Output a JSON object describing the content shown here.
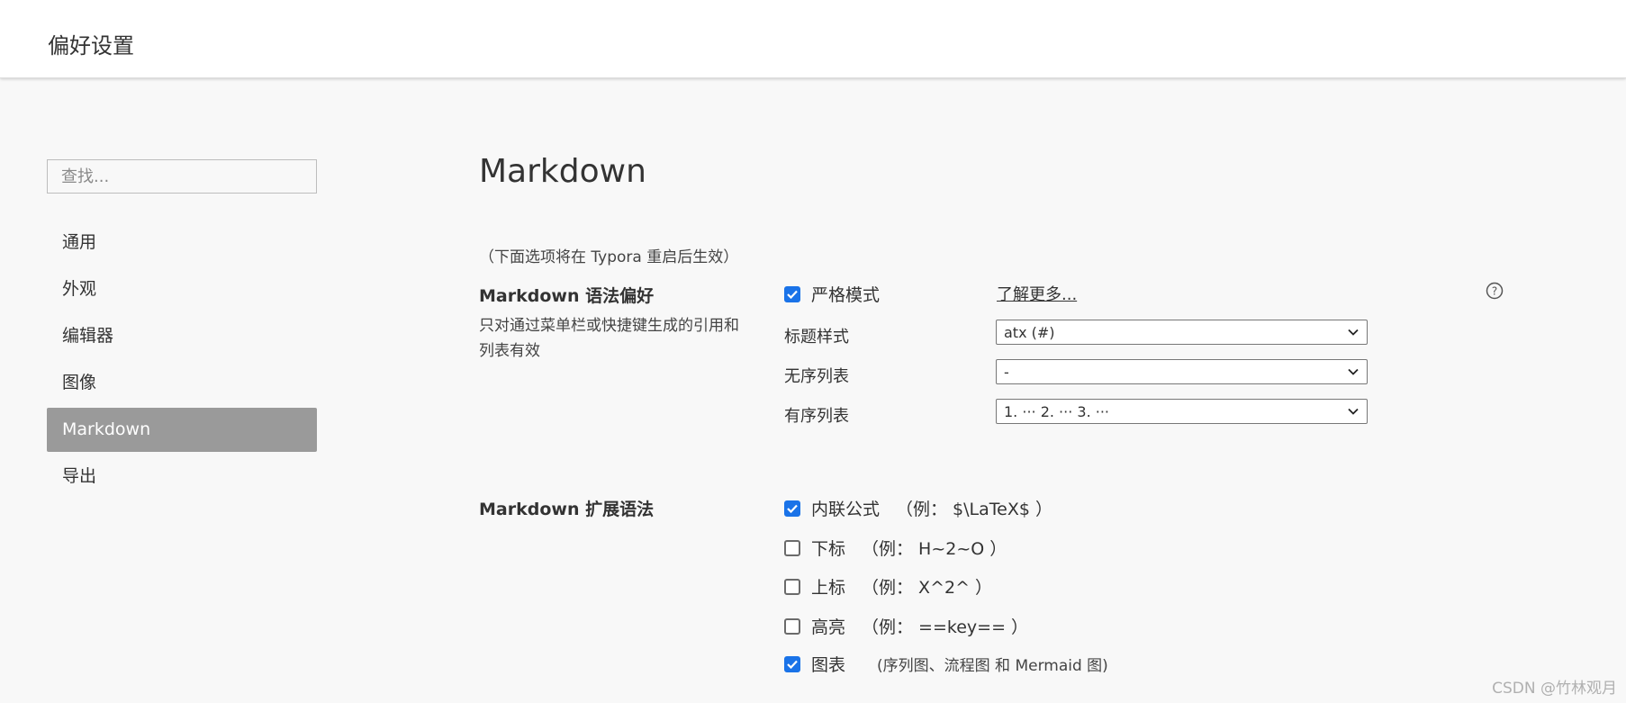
{
  "window": {
    "title": "偏好设置"
  },
  "search": {
    "placeholder": "查找..."
  },
  "sidebar": {
    "items": [
      {
        "label": "通用"
      },
      {
        "label": "外观"
      },
      {
        "label": "编辑器"
      },
      {
        "label": "图像"
      },
      {
        "label": "Markdown",
        "active": true
      },
      {
        "label": "导出"
      }
    ]
  },
  "main": {
    "title": "Markdown",
    "restart_note": "（下面选项将在 Typora 重启后生效）",
    "syntax_pref": {
      "title": "Markdown 语法偏好",
      "description": "只对通过菜单栏或快捷键生成的引用和列表有效",
      "strict_mode": {
        "label": "严格模式",
        "checked": true
      },
      "learn_more": "了解更多...",
      "heading_style": {
        "label": "标题样式",
        "value": "atx (#)"
      },
      "unordered_list": {
        "label": "无序列表",
        "value": "-"
      },
      "ordered_list": {
        "label": "有序列表",
        "value": "1. ··· 2. ··· 3. ···"
      }
    },
    "extensions": {
      "title": "Markdown 扩展语法",
      "items": [
        {
          "label": "内联公式",
          "example": "（例：  $\\LaTeX$ ）",
          "checked": true
        },
        {
          "label": "下标",
          "example": "（例：  H~2~O ）",
          "checked": false
        },
        {
          "label": "上标",
          "example": "（例：  X^2^ ）",
          "checked": false
        },
        {
          "label": "高亮",
          "example": "（例：  ==key== ）",
          "checked": false
        },
        {
          "label": "图表",
          "example": "(序列图、流程图 和 Mermaid 图)",
          "checked": true
        }
      ]
    }
  },
  "watermark": "CSDN @竹林观月",
  "colors": {
    "accent": "#1a73e8",
    "active_nav": "#9a9a9a",
    "background": "#f8f8f8"
  },
  "icons": {
    "help": "question-circle-icon",
    "dropdown": "chevron-down-icon",
    "check": "checkmark-icon"
  }
}
